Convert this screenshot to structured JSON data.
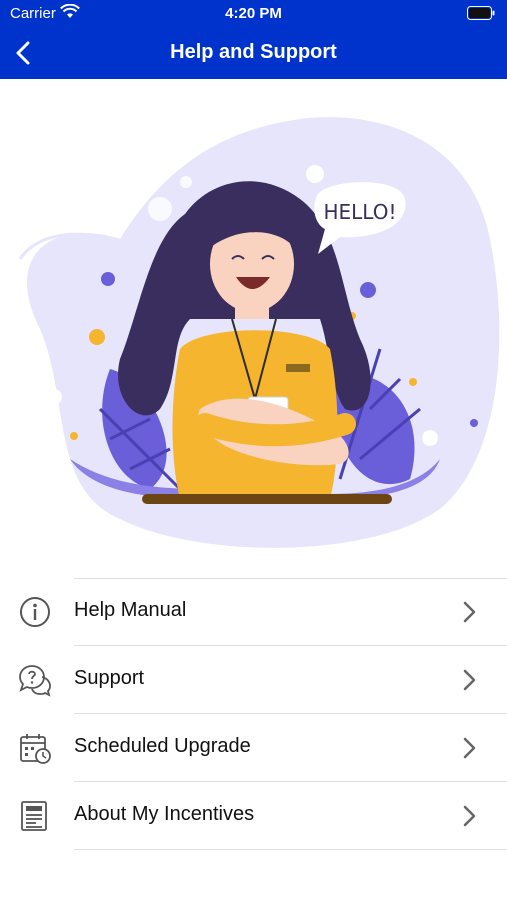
{
  "status_bar": {
    "carrier": "Carrier",
    "time": "4:20 PM"
  },
  "nav": {
    "title": "Help and Support"
  },
  "illustration": {
    "speech_text": "HELLO!"
  },
  "menu": {
    "items": [
      {
        "label": "Help Manual",
        "icon": "info-icon"
      },
      {
        "label": "Support",
        "icon": "chat-question-icon"
      },
      {
        "label": "Scheduled Upgrade",
        "icon": "calendar-clock-icon"
      },
      {
        "label": "About My Incentives",
        "icon": "document-icon"
      }
    ]
  },
  "colors": {
    "header": "#0033cc",
    "illustration_blob": "#e6e5fb",
    "accent_purple": "#6b5ed9",
    "shirt": "#f5b52e"
  }
}
